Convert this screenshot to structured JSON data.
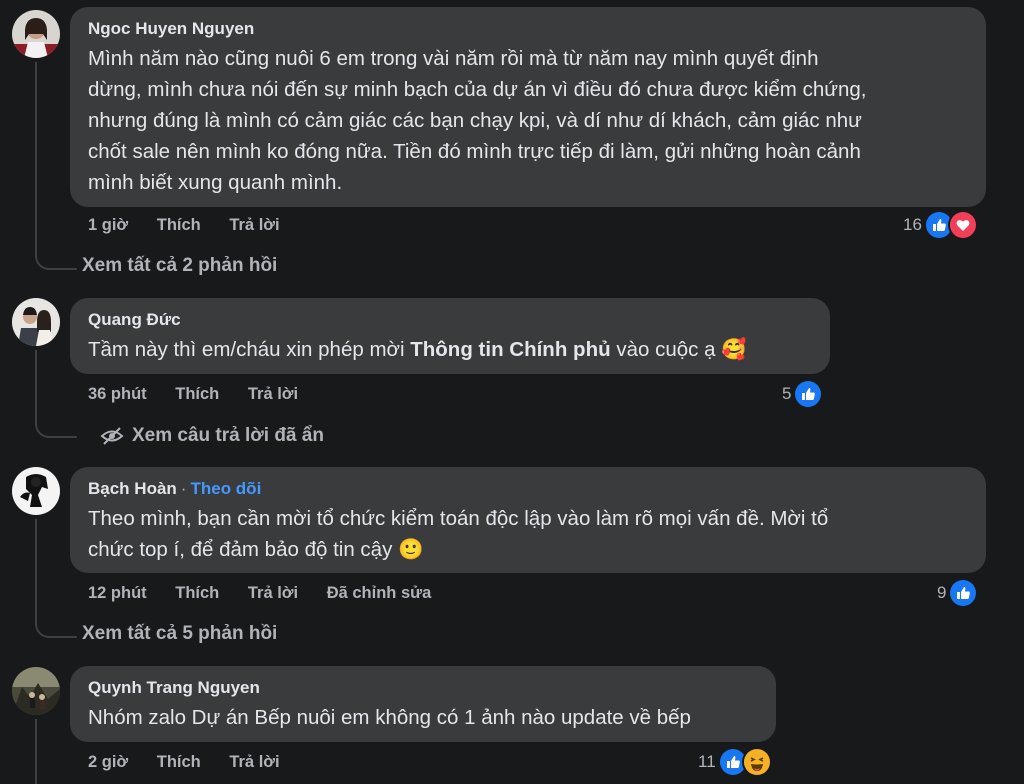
{
  "comments": [
    {
      "author": "Ngoc Huyen Nguyen",
      "lines": [
        "Mình năm nào cũng nuôi 6 em trong vài năm rồi mà từ năm nay mình quyết định",
        "dừng, mình chưa nói đến sự minh bạch của dự án vì điều đó chưa được kiểm chứng,",
        "nhưng đúng là mình có cảm giác các bạn chạy kpi, và dí như dí khách, cảm giác như",
        "chốt sale nên mình ko đóng nữa. Tiền đó mình trực tiếp đi làm, gửi những hoàn cảnh",
        "mình biết xung quanh mình."
      ],
      "time": "1 giờ",
      "like_label": "Thích",
      "reply_label": "Trả lời",
      "reaction_count": "16",
      "reactions": [
        "like-icon",
        "love-icon"
      ],
      "view_replies": "Xem tất cả 2 phản hồi"
    },
    {
      "author": "Quang Đức",
      "text_before": "Tầm này thì em/cháu xin phép mời ",
      "text_bold": "Thông tin Chính phủ",
      "text_after": " vào cuộc ạ 🥰",
      "time": "36 phút",
      "like_label": "Thích",
      "reply_label": "Trả lời",
      "reaction_count": "5",
      "reactions": [
        "like-icon"
      ],
      "view_replies": "Xem câu trả lời đã ẩn"
    },
    {
      "author": "Bạch Hoàn",
      "separator": "·",
      "follow_label": "Theo dõi",
      "lines": [
        "Theo mình, bạn cần mời tổ chức kiểm toán độc lập vào làm rõ mọi vấn đề. Mời tổ",
        "chức top í, để đảm bảo độ tin cậy 🙂"
      ],
      "time": "12 phút",
      "like_label": "Thích",
      "reply_label": "Trả lời",
      "edited_label": "Đã chỉnh sửa",
      "reaction_count": "9",
      "reactions": [
        "like-icon"
      ],
      "view_replies": "Xem tất cả 5 phản hồi"
    },
    {
      "author": "Quynh Trang Nguyen",
      "lines": [
        "Nhóm zalo Dự án Bếp nuôi em không có 1 ảnh nào update về bếp"
      ],
      "time": "2 giờ",
      "like_label": "Thích",
      "reply_label": "Trả lời",
      "reaction_count": "11",
      "reactions": [
        "like-icon",
        "haha-icon"
      ]
    }
  ],
  "colors": {
    "background": "#18191a",
    "bubble": "#3a3b3c",
    "text": "#e4e6eb",
    "secondary": "#b0b3b8",
    "link": "#4599ff",
    "like": "#1877f2",
    "love": "#f33e58"
  }
}
